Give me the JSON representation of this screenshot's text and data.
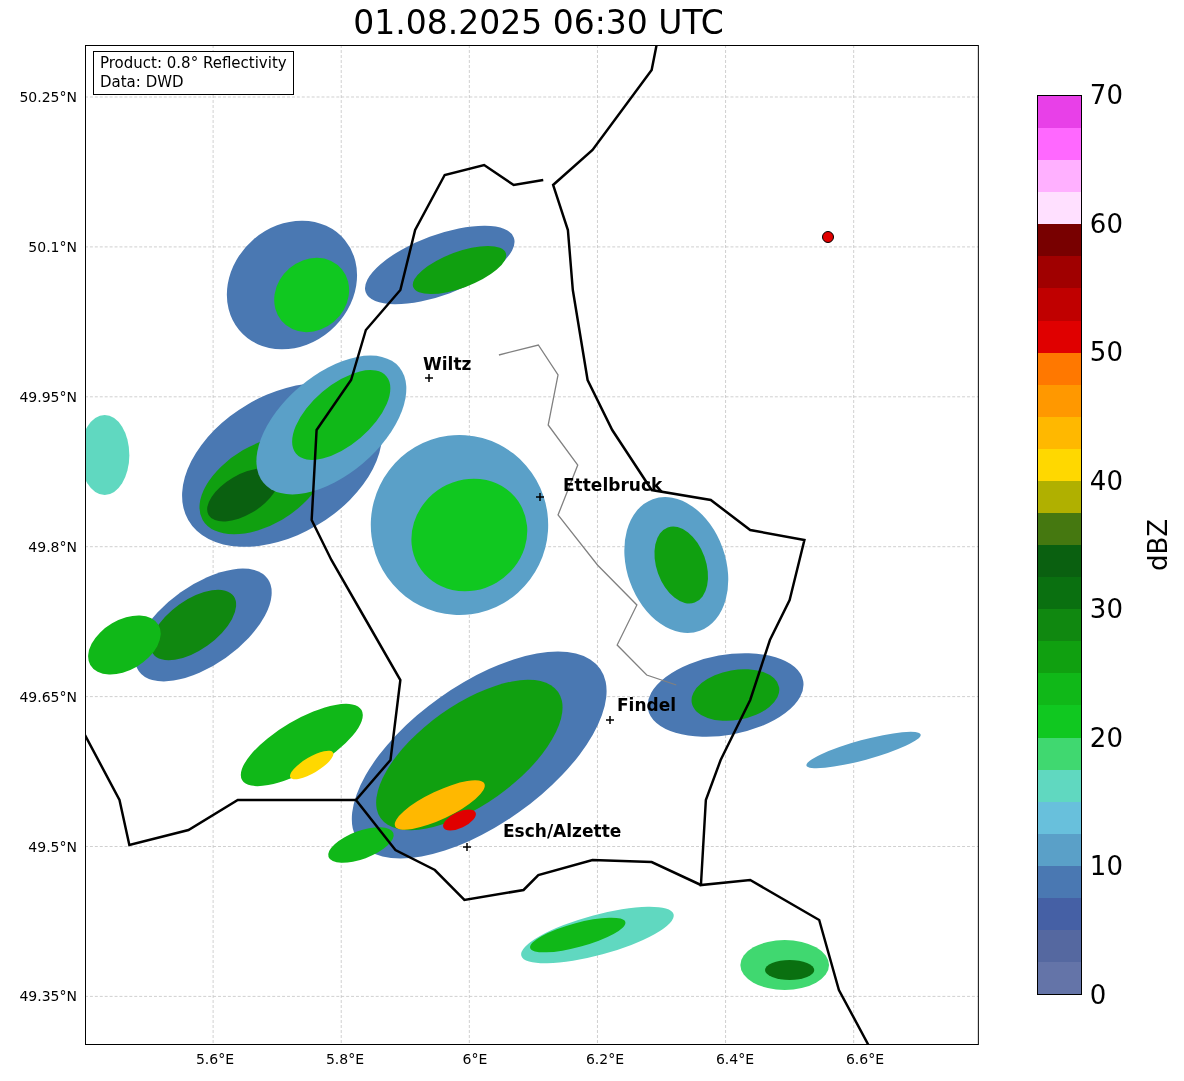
{
  "title": "01.08.2025 06:30 UTC",
  "legend": [
    "Product: 0.8° Reflectivity",
    "Data: DWD"
  ],
  "map": {
    "lat_ticks": [
      "50.25°N",
      "50.1°N",
      "49.95°N",
      "49.8°N",
      "49.65°N",
      "49.5°N",
      "49.35°N"
    ],
    "lon_ticks": [
      "5.6°E",
      "5.8°E",
      "6°E",
      "6.2°E",
      "6.4°E",
      "6.6°E"
    ],
    "cities": [
      {
        "name": "Wiltz"
      },
      {
        "name": "Ettelbruck"
      },
      {
        "name": "Findel"
      },
      {
        "name": "Esch/Alzette"
      }
    ]
  },
  "colorbar": {
    "label": "dBZ",
    "ticks": [
      "70",
      "60",
      "50",
      "40",
      "30",
      "20",
      "10",
      "0"
    ],
    "segments": [
      {
        "color": "#6474a8"
      },
      {
        "color": "#5568a0"
      },
      {
        "color": "#4560a5"
      },
      {
        "color": "#4a78b2"
      },
      {
        "color": "#5aa0c8"
      },
      {
        "color": "#68c0dc"
      },
      {
        "color": "#60d8c0"
      },
      {
        "color": "#40d870"
      },
      {
        "color": "#10c820"
      },
      {
        "color": "#10b818"
      },
      {
        "color": "#10a010"
      },
      {
        "color": "#108810"
      },
      {
        "color": "#0a7010"
      },
      {
        "color": "#0a6010"
      },
      {
        "color": "#457810"
      },
      {
        "color": "#b0b000"
      },
      {
        "color": "#ffd800"
      },
      {
        "color": "#ffb800"
      },
      {
        "color": "#ff9800"
      },
      {
        "color": "#ff7800"
      },
      {
        "color": "#e00000"
      },
      {
        "color": "#c00000"
      },
      {
        "color": "#a00000"
      },
      {
        "color": "#780000"
      },
      {
        "color": "#ffe0ff"
      },
      {
        "color": "#ffb0ff"
      },
      {
        "color": "#ff68ff"
      },
      {
        "color": "#e840e8"
      }
    ]
  }
}
